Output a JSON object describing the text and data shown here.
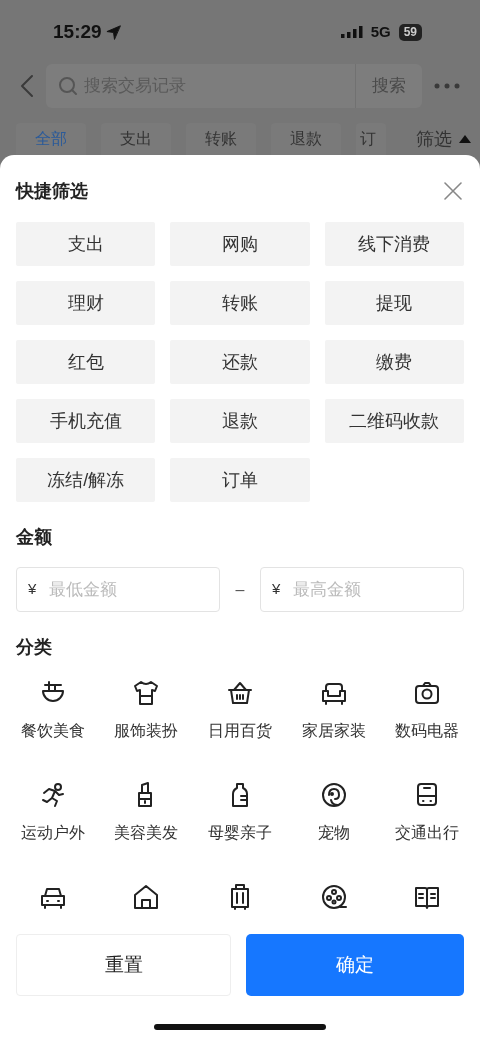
{
  "status_bar": {
    "time": "15:29",
    "network": "5G",
    "battery": "59"
  },
  "header": {
    "search_placeholder": "搜索交易记录",
    "search_button": "搜索"
  },
  "tabs": [
    {
      "label": "全部",
      "selected": true
    },
    {
      "label": "支出",
      "selected": false
    },
    {
      "label": "转账",
      "selected": false
    },
    {
      "label": "退款",
      "selected": false
    },
    {
      "label": "订",
      "selected": false
    }
  ],
  "filter_toggle": "筛选",
  "sheet": {
    "title": "快捷筛选",
    "quick_filters": [
      "支出",
      "网购",
      "线下消费",
      "理财",
      "转账",
      "提现",
      "红包",
      "还款",
      "缴费",
      "手机充值",
      "退款",
      "二维码收款",
      "冻结/解冻",
      "订单"
    ],
    "amount": {
      "title": "金额",
      "currency_min": "¥",
      "min_placeholder": "最低金额",
      "separator": "–",
      "currency_max": "¥",
      "max_placeholder": "最高金额"
    },
    "categories": {
      "title": "分类",
      "items": [
        {
          "kind": "labeled",
          "label": "餐饮美食"
        },
        {
          "kind": "labeled",
          "label": "服饰装扮"
        },
        {
          "kind": "labeled",
          "label": "日用百货"
        },
        {
          "kind": "labeled",
          "label": "家居家装"
        },
        {
          "kind": "labeled",
          "label": "数码电器"
        },
        {
          "kind": "labeled",
          "label": "运动户外"
        },
        {
          "kind": "labeled",
          "label": "美容美发"
        },
        {
          "kind": "labeled",
          "label": "母婴亲子"
        },
        {
          "kind": "labeled",
          "label": "宠物"
        },
        {
          "kind": "labeled",
          "label": "交通出行"
        },
        {
          "kind": "icon_only"
        },
        {
          "kind": "icon_only"
        },
        {
          "kind": "icon_only"
        },
        {
          "kind": "icon_only"
        },
        {
          "kind": "icon_only"
        }
      ]
    },
    "buttons": {
      "reset": "重置",
      "confirm": "确定"
    }
  }
}
